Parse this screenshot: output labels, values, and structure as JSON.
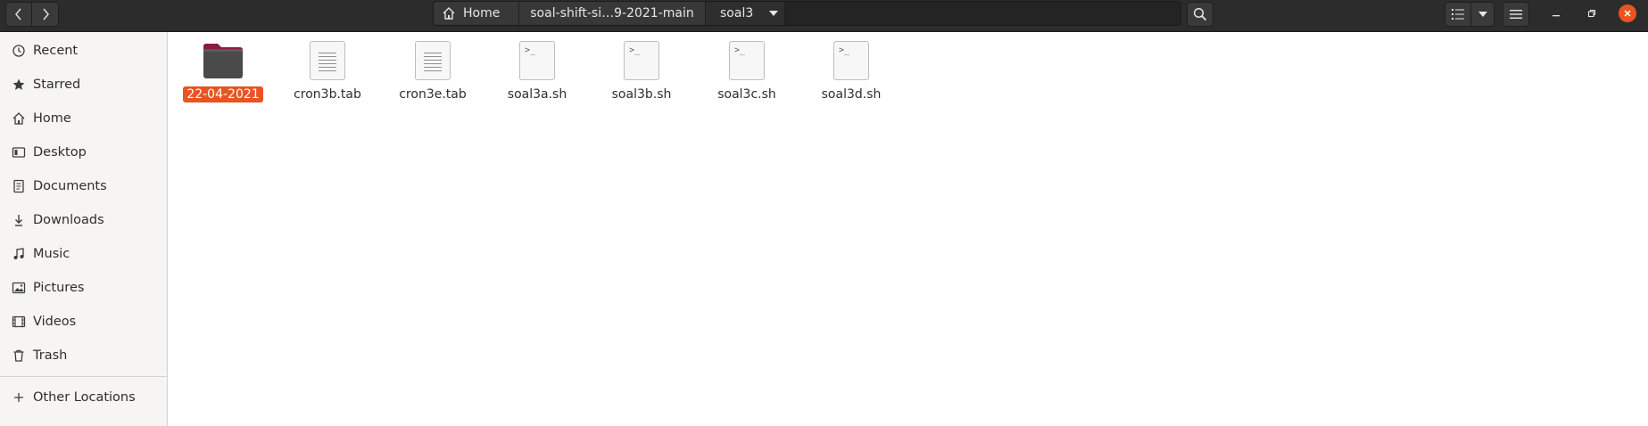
{
  "header": {
    "back_icon": "chevron-left-icon",
    "forward_icon": "chevron-right-icon",
    "breadcrumbs": [
      {
        "label": "Home",
        "icon": "home-icon"
      },
      {
        "label": "soal-shift-si…9-2021-main"
      },
      {
        "label": "soal3"
      }
    ],
    "search_icon": "search-icon",
    "view_icon": "list-view-icon",
    "menu_icon": "hamburger-menu-icon"
  },
  "sidebar": {
    "items": [
      {
        "label": "Recent",
        "icon": "clock-icon"
      },
      {
        "label": "Starred",
        "icon": "star-icon"
      },
      {
        "label": "Home",
        "icon": "home-icon"
      },
      {
        "label": "Desktop",
        "icon": "desktop-icon"
      },
      {
        "label": "Documents",
        "icon": "documents-icon"
      },
      {
        "label": "Downloads",
        "icon": "download-icon"
      },
      {
        "label": "Music",
        "icon": "music-icon"
      },
      {
        "label": "Pictures",
        "icon": "pictures-icon"
      },
      {
        "label": "Videos",
        "icon": "videos-icon"
      },
      {
        "label": "Trash",
        "icon": "trash-icon"
      }
    ],
    "other_locations": {
      "label": "Other Locations",
      "icon": "plus-icon"
    }
  },
  "files": [
    {
      "name": "22-04-2021",
      "type": "folder",
      "selected": true
    },
    {
      "name": "cron3b.tab",
      "type": "text"
    },
    {
      "name": "cron3e.tab",
      "type": "text"
    },
    {
      "name": "soal3a.sh",
      "type": "script"
    },
    {
      "name": "soal3b.sh",
      "type": "script"
    },
    {
      "name": "soal3c.sh",
      "type": "script"
    },
    {
      "name": "soal3d.sh",
      "type": "script"
    }
  ],
  "colors": {
    "accent": "#e95420",
    "headerbar": "#2c2c2c",
    "folder": "#4a4a4a",
    "folder_tab": "#8a1b3c"
  }
}
